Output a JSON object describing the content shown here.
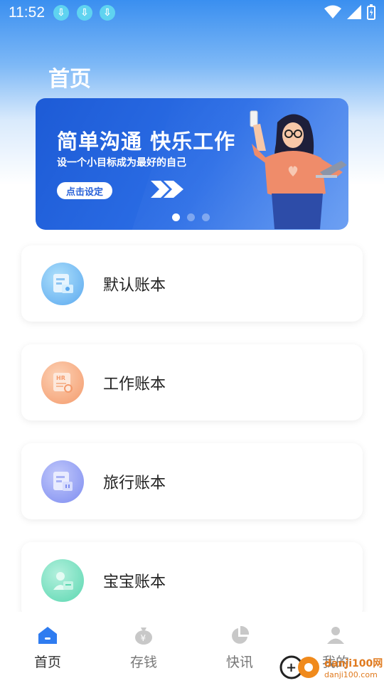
{
  "status_bar": {
    "time": "11:52",
    "download_icons": [
      "download-icon",
      "download-icon",
      "download-icon"
    ],
    "signal_icons": [
      "wifi-icon",
      "cell-signal-icon",
      "battery-icon"
    ]
  },
  "header": {
    "title": "首页"
  },
  "banner": {
    "headline": "简单沟通 快乐工作",
    "subline": "设一个小目标成为最好的自己",
    "button_label": "点击设定",
    "dots_count": 3,
    "active_dot": 0
  },
  "ledgers": [
    {
      "label": "默认账本",
      "icon": "ledger-default-icon",
      "color": "#5aa8ef"
    },
    {
      "label": "工作账本",
      "icon": "ledger-work-icon",
      "color": "#f49a6b"
    },
    {
      "label": "旅行账本",
      "icon": "ledger-travel-icon",
      "color": "#7d8cf0"
    },
    {
      "label": "宝宝账本",
      "icon": "ledger-baby-icon",
      "color": "#5ad7b0"
    }
  ],
  "tabs": [
    {
      "label": "首页",
      "icon": "home-icon",
      "active": true
    },
    {
      "label": "存钱",
      "icon": "money-bag-icon",
      "active": false
    },
    {
      "label": "快讯",
      "icon": "pie-chart-icon",
      "active": false
    },
    {
      "label": "我的",
      "icon": "user-icon",
      "active": false
    }
  ],
  "watermark": {
    "text": "danji100网",
    "sub": "danji100.com"
  },
  "colors": {
    "accent": "#2c6ee6",
    "tab_active": "#2f7cf0",
    "tab_inactive": "#c8c8c8"
  }
}
